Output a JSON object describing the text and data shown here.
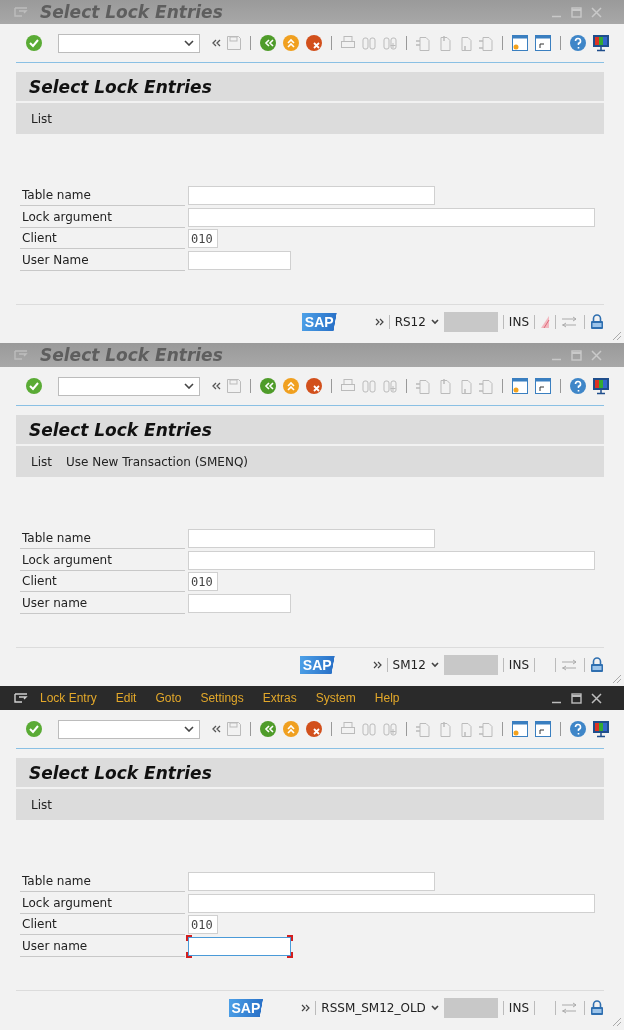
{
  "windows": [
    {
      "header": {
        "kind": "title",
        "title": "Select Lock Entries"
      },
      "screen_title": "Select Lock Entries",
      "app_toolbar": [
        "List"
      ],
      "fields": [
        {
          "label": "Table name",
          "focused": false
        },
        {
          "label": "Lock argument",
          "focused": false
        },
        {
          "label": "Client",
          "value": "010",
          "focused": false
        },
        {
          "label": "User Name",
          "focused": false
        }
      ],
      "status": {
        "logo": "SAP",
        "transaction": "RS12",
        "mode": "INS",
        "indicator": true
      }
    },
    {
      "header": {
        "kind": "title",
        "title": "Select Lock Entries"
      },
      "screen_title": "Select Lock Entries",
      "app_toolbar": [
        "List",
        "Use New Transaction (SMENQ)"
      ],
      "fields": [
        {
          "label": "Table name",
          "focused": false
        },
        {
          "label": "Lock argument",
          "focused": false
        },
        {
          "label": "Client",
          "value": "010",
          "focused": false
        },
        {
          "label": "User name",
          "focused": false
        }
      ],
      "status": {
        "logo": "SAP",
        "transaction": "SM12",
        "mode": "INS",
        "indicator": false
      }
    },
    {
      "header": {
        "kind": "menu",
        "menu": [
          "Lock Entry",
          "Edit",
          "Goto",
          "Settings",
          "Extras",
          "System",
          "Help"
        ]
      },
      "screen_title": "Select Lock Entries",
      "app_toolbar": [
        "List"
      ],
      "fields": [
        {
          "label": "Table name",
          "focused": false
        },
        {
          "label": "Lock argument",
          "focused": false
        },
        {
          "label": "Client",
          "value": "010",
          "focused": false
        },
        {
          "label": "User name",
          "focused": true
        }
      ],
      "status": {
        "logo": "SAP",
        "transaction": "RSSM_SM12_OLD",
        "mode": "INS",
        "indicator": false
      }
    }
  ]
}
